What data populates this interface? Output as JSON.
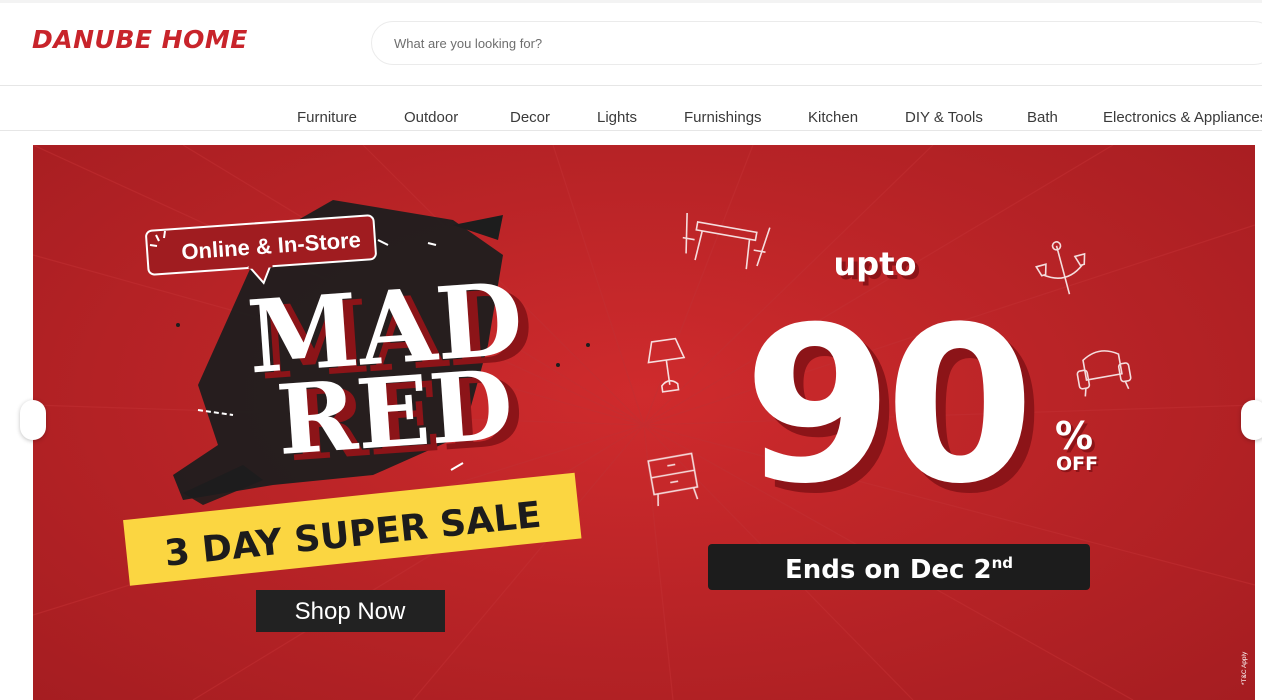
{
  "brand": {
    "name": "DANUBE HOME",
    "color": "#c8242b"
  },
  "search": {
    "placeholder": "What are you looking for?"
  },
  "nav": {
    "items": [
      "Furniture",
      "Outdoor",
      "Decor",
      "Lights",
      "Furnishings",
      "Kitchen",
      "DIY & Tools",
      "Bath",
      "Electronics & Appliances"
    ]
  },
  "banner": {
    "tag": "Online & In-Store",
    "title_line1": "MAD",
    "title_line2": "RED",
    "subtitle": "3 DAY SUPER SALE",
    "cta": "Shop Now",
    "upto": "upto",
    "discount": "90",
    "percent": "%",
    "off": "OFF",
    "ends_prefix": "Ends on Dec 2",
    "ends_suffix": "nd",
    "terms": "*T&C Apply",
    "colors": {
      "background": "#b72326",
      "accent_yellow": "#fbd641",
      "dark": "#1c1c1c"
    },
    "icons": [
      "table-chairs-icon",
      "chandelier-icon",
      "table-lamp-icon",
      "armchair-icon",
      "side-table-icon"
    ]
  },
  "carousel": {
    "prev_icon": "chevron-left-icon",
    "next_icon": "chevron-right-icon"
  }
}
